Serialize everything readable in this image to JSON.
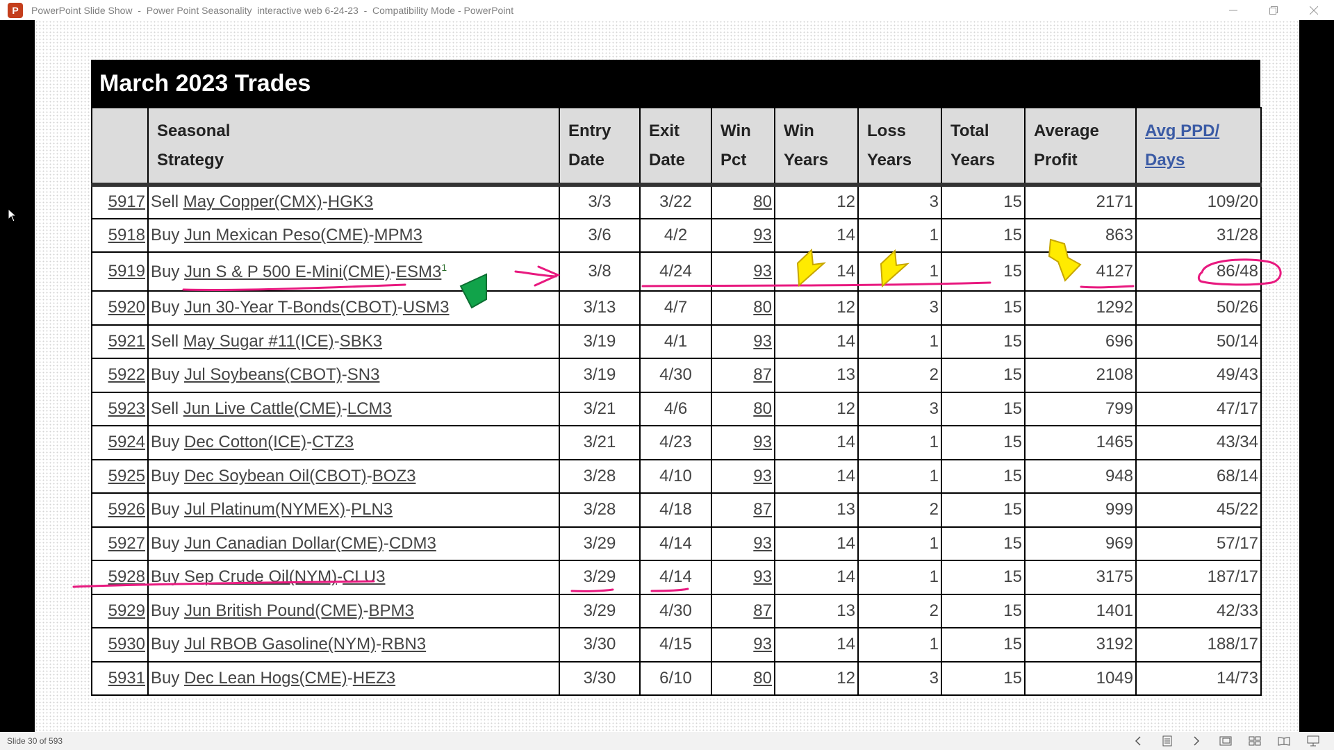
{
  "window": {
    "title": "PowerPoint Slide Show  -  Power Point Seasonality  interactive web 6-24-23  -  Compatibility Mode - PowerPoint",
    "app_icon": "P"
  },
  "table": {
    "title": "March 2023 Trades",
    "headers": [
      {
        "line1": "",
        "line2": ""
      },
      {
        "line1": "Seasonal",
        "line2": "Strategy"
      },
      {
        "line1": "Entry",
        "line2": "Date"
      },
      {
        "line1": "Exit",
        "line2": "Date"
      },
      {
        "line1": "Win",
        "line2": "Pct"
      },
      {
        "line1": "Win",
        "line2": "Years"
      },
      {
        "line1": "Loss",
        "line2": "Years"
      },
      {
        "line1": "Total",
        "line2": "Years"
      },
      {
        "line1": "Average",
        "line2": "Profit"
      },
      {
        "line1": "Avg PPD/",
        "line2": "Days"
      }
    ],
    "rows": [
      {
        "id": "5917",
        "action": "Sell",
        "market": "May Copper(CMX)",
        "symbol": "HGK3",
        "sup": "",
        "entry": "3/3",
        "exit": "3/22",
        "win_pct": "80",
        "win_years": "12",
        "loss_years": "3",
        "total_years": "15",
        "avg_profit": "2171",
        "ppd": "109/20"
      },
      {
        "id": "5918",
        "action": "Buy",
        "market": "Jun Mexican Peso(CME)",
        "symbol": "MPM3",
        "sup": "",
        "entry": "3/6",
        "exit": "4/2",
        "win_pct": "93",
        "win_years": "14",
        "loss_years": "1",
        "total_years": "15",
        "avg_profit": "863",
        "ppd": "31/28"
      },
      {
        "id": "5919",
        "action": "Buy",
        "market": "Jun S & P 500 E-Mini(CME)",
        "symbol": "ESM3",
        "sup": "1",
        "entry": "3/8",
        "exit": "4/24",
        "win_pct": "93",
        "win_years": "14",
        "loss_years": "1",
        "total_years": "15",
        "avg_profit": "4127",
        "ppd": "86/48"
      },
      {
        "id": "5920",
        "action": "Buy",
        "market": "Jun 30-Year T-Bonds(CBOT)",
        "symbol": "USM3",
        "sup": "",
        "entry": "3/13",
        "exit": "4/7",
        "win_pct": "80",
        "win_years": "12",
        "loss_years": "3",
        "total_years": "15",
        "avg_profit": "1292",
        "ppd": "50/26"
      },
      {
        "id": "5921",
        "action": "Sell",
        "market": "May Sugar #11(ICE)",
        "symbol": "SBK3",
        "sup": "",
        "entry": "3/19",
        "exit": "4/1",
        "win_pct": "93",
        "win_years": "14",
        "loss_years": "1",
        "total_years": "15",
        "avg_profit": "696",
        "ppd": "50/14"
      },
      {
        "id": "5922",
        "action": "Buy",
        "market": "Jul Soybeans(CBOT)",
        "symbol": "SN3",
        "sup": "",
        "entry": "3/19",
        "exit": "4/30",
        "win_pct": "87",
        "win_years": "13",
        "loss_years": "2",
        "total_years": "15",
        "avg_profit": "2108",
        "ppd": "49/43"
      },
      {
        "id": "5923",
        "action": "Sell",
        "market": "Jun Live Cattle(CME)",
        "symbol": "LCM3",
        "sup": "",
        "entry": "3/21",
        "exit": "4/6",
        "win_pct": "80",
        "win_years": "12",
        "loss_years": "3",
        "total_years": "15",
        "avg_profit": "799",
        "ppd": "47/17"
      },
      {
        "id": "5924",
        "action": "Buy",
        "market": "Dec Cotton(ICE)",
        "symbol": "CTZ3",
        "sup": "",
        "entry": "3/21",
        "exit": "4/23",
        "win_pct": "93",
        "win_years": "14",
        "loss_years": "1",
        "total_years": "15",
        "avg_profit": "1465",
        "ppd": "43/34"
      },
      {
        "id": "5925",
        "action": "Buy",
        "market": "Dec Soybean Oil(CBOT)",
        "symbol": "BOZ3",
        "sup": "",
        "entry": "3/28",
        "exit": "4/10",
        "win_pct": "93",
        "win_years": "14",
        "loss_years": "1",
        "total_years": "15",
        "avg_profit": "948",
        "ppd": "68/14"
      },
      {
        "id": "5926",
        "action": "Buy",
        "market": "Jul Platinum(NYMEX)",
        "symbol": "PLN3",
        "sup": "",
        "entry": "3/28",
        "exit": "4/18",
        "win_pct": "87",
        "win_years": "13",
        "loss_years": "2",
        "total_years": "15",
        "avg_profit": "999",
        "ppd": "45/22"
      },
      {
        "id": "5927",
        "action": "Buy",
        "market": "Jun Canadian Dollar(CME)",
        "symbol": "CDM3",
        "sup": "",
        "entry": "3/29",
        "exit": "4/14",
        "win_pct": "93",
        "win_years": "14",
        "loss_years": "1",
        "total_years": "15",
        "avg_profit": "969",
        "ppd": "57/17"
      },
      {
        "id": "5928",
        "action": "Buy",
        "market": "Sep Crude Oil(NYM)",
        "symbol": "CLU3",
        "sup": "",
        "entry": "3/29",
        "exit": "4/14",
        "win_pct": "93",
        "win_years": "14",
        "loss_years": "1",
        "total_years": "15",
        "avg_profit": "3175",
        "ppd": "187/17"
      },
      {
        "id": "5929",
        "action": "Buy",
        "market": "Jun British Pound(CME)",
        "symbol": "BPM3",
        "sup": "",
        "entry": "3/29",
        "exit": "4/30",
        "win_pct": "87",
        "win_years": "13",
        "loss_years": "2",
        "total_years": "15",
        "avg_profit": "1401",
        "ppd": "42/33"
      },
      {
        "id": "5930",
        "action": "Buy",
        "market": "Jul RBOB Gasoline(NYM)",
        "symbol": "RBN3",
        "sup": "",
        "entry": "3/30",
        "exit": "4/15",
        "win_pct": "93",
        "win_years": "14",
        "loss_years": "1",
        "total_years": "15",
        "avg_profit": "3192",
        "ppd": "188/17"
      },
      {
        "id": "5931",
        "action": "Buy",
        "market": "Dec Lean Hogs(CME)",
        "symbol": "HEZ3",
        "sup": "",
        "entry": "3/30",
        "exit": "6/10",
        "win_pct": "80",
        "win_years": "12",
        "loss_years": "3",
        "total_years": "15",
        "avg_profit": "1049",
        "ppd": "14/73"
      }
    ]
  },
  "statusbar": {
    "slide_counter": "Slide 30 of 593",
    "icons": [
      "previous-icon",
      "slide-menu-icon",
      "next-icon",
      "normal-view-icon",
      "slide-sorter-icon",
      "reading-view-icon",
      "slideshow-icon"
    ]
  },
  "colors": {
    "annotation_pink": "#e8197f",
    "arrow_yellow": "#ffeb00",
    "arrow_green": "#11a34a",
    "link_blue": "#3b5ba5"
  }
}
